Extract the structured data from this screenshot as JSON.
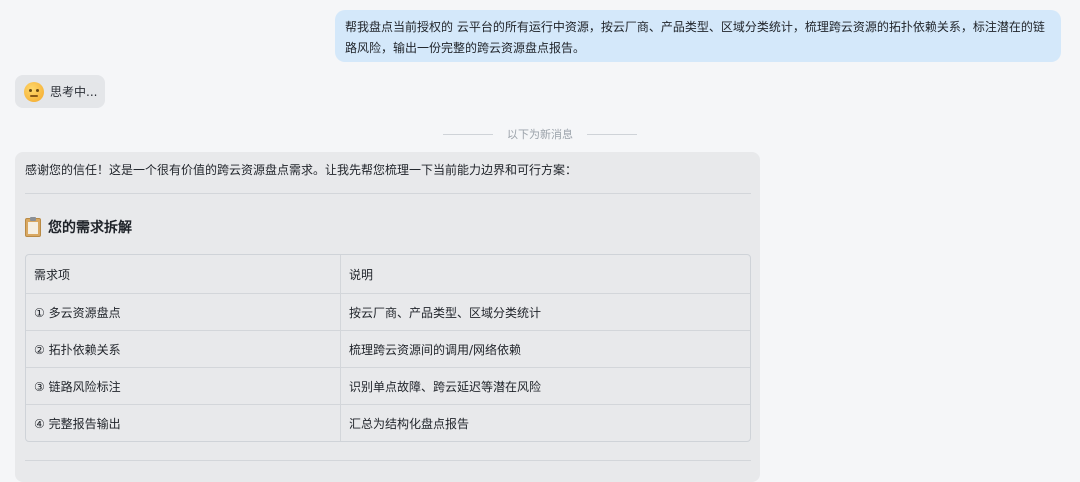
{
  "user_message": "帮我盘点当前授权的 云平台的所有运行中资源，按云厂商、产品类型、区域分类统计，梳理跨云资源的拓扑依赖关系，标注潜在的链路风险，输出一份完整的跨云资源盘点报告。",
  "thinking": {
    "label": "思考中..."
  },
  "divider_label": "以下为新消息",
  "reply": {
    "intro": "感谢您的信任！这是一个很有价值的跨云资源盘点需求。让我先帮您梳理一下当前能力边界和可行方案：",
    "section_title": "您的需求拆解",
    "table": {
      "headers": [
        "需求项",
        "说明"
      ],
      "rows": [
        [
          "① 多云资源盘点",
          "按云厂商、产品类型、区域分类统计"
        ],
        [
          "② 拓扑依赖关系",
          "梳理跨云资源间的调用/网络依赖"
        ],
        [
          "③ 链路风险标注",
          "识别单点故障、跨云延迟等潜在风险"
        ],
        [
          "④ 完整报告输出",
          "汇总为结构化盘点报告"
        ]
      ]
    }
  },
  "colors": {
    "background": "#f5f6f8",
    "user_bubble": "#d4e8fa",
    "reply_card": "#e8e9eb"
  }
}
